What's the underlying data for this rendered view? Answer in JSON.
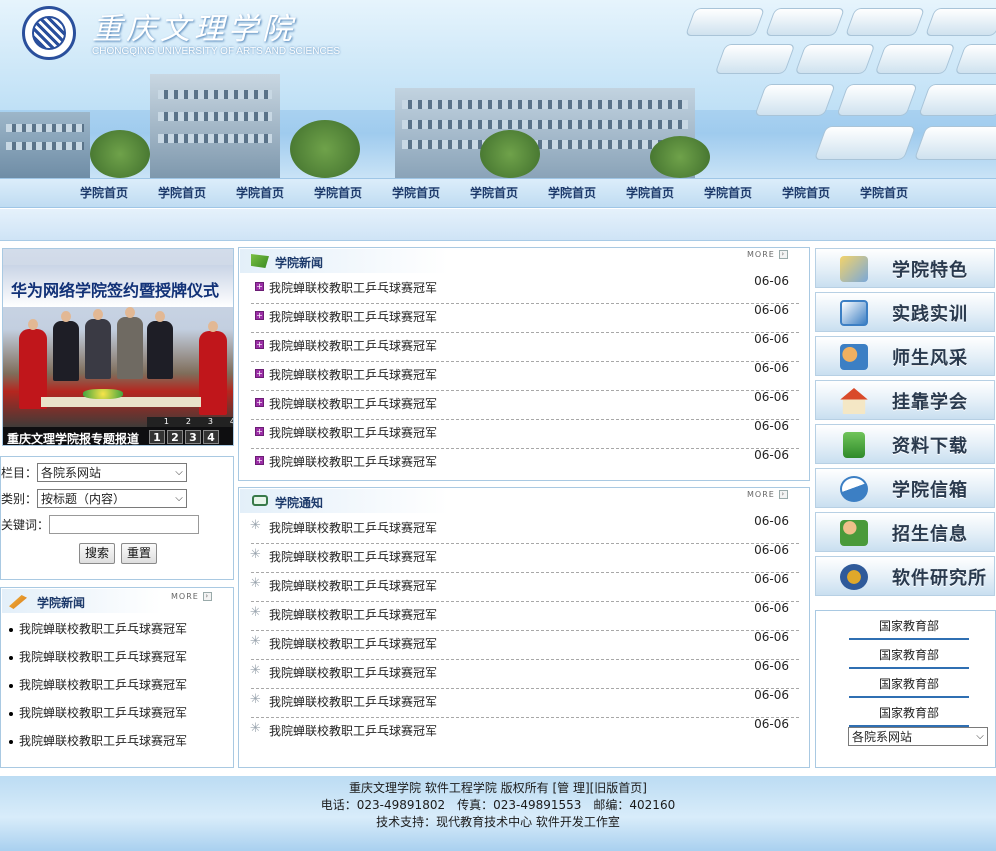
{
  "header": {
    "school_name_cn": "重庆文理学院",
    "school_name_en": "CHONGQING UNIVERSITY OF ARTS AND SCIENCES"
  },
  "nav": {
    "items": [
      "学院首页",
      "学院首页",
      "学院首页",
      "学院首页",
      "学院首页",
      "学院首页",
      "学院首页",
      "学院首页",
      "学院首页",
      "学院首页",
      "学院首页"
    ]
  },
  "slideshow": {
    "banner_text": "华为网络学院签约暨授牌仪式",
    "caption": "重庆文理学院报专题报道",
    "pages": [
      "1",
      "2",
      "3",
      "4"
    ],
    "small_pages": [
      "1",
      "2",
      "3",
      "4"
    ]
  },
  "search": {
    "column_label": "栏目：",
    "column_value": "各院系网站",
    "type_label": "类别：",
    "type_value": "按标题（内容）",
    "keyword_label": "关键词：",
    "keyword_value": "",
    "search_button": "搜索",
    "reset_button": "重置"
  },
  "left_news": {
    "title": "学院新闻",
    "more": "MORE",
    "items": [
      "我院蝉联校教职工乒乓球赛冠军",
      "我院蝉联校教职工乒乓球赛冠军",
      "我院蝉联校教职工乒乓球赛冠军",
      "我院蝉联校教职工乒乓球赛冠军",
      "我院蝉联校教职工乒乓球赛冠军"
    ]
  },
  "center_news": {
    "title": "学院新闻",
    "more": "MORE",
    "items": [
      {
        "title": "我院蝉联校教职工乒乓球赛冠军",
        "date": "06-06"
      },
      {
        "title": "我院蝉联校教职工乒乓球赛冠军",
        "date": "06-06"
      },
      {
        "title": "我院蝉联校教职工乒乓球赛冠军",
        "date": "06-06"
      },
      {
        "title": "我院蝉联校教职工乒乓球赛冠军",
        "date": "06-06"
      },
      {
        "title": "我院蝉联校教职工乒乓球赛冠军",
        "date": "06-06"
      },
      {
        "title": "我院蝉联校教职工乒乓球赛冠军",
        "date": "06-06"
      },
      {
        "title": "我院蝉联校教职工乒乓球赛冠军",
        "date": "06-06"
      }
    ]
  },
  "center_notice": {
    "title": "学院通知",
    "more": "MORE",
    "items": [
      {
        "title": "我院蝉联校教职工乒乓球赛冠军",
        "date": "06-06"
      },
      {
        "title": "我院蝉联校教职工乒乓球赛冠军",
        "date": "06-06"
      },
      {
        "title": "我院蝉联校教职工乒乓球赛冠军",
        "date": "06-06"
      },
      {
        "title": "我院蝉联校教职工乒乓球赛冠军",
        "date": "06-06"
      },
      {
        "title": "我院蝉联校教职工乒乓球赛冠军",
        "date": "06-06"
      },
      {
        "title": "我院蝉联校教职工乒乓球赛冠军",
        "date": "06-06"
      },
      {
        "title": "我院蝉联校教职工乒乓球赛冠军",
        "date": "06-06"
      },
      {
        "title": "我院蝉联校教职工乒乓球赛冠军",
        "date": "06-06"
      }
    ]
  },
  "right_menu": [
    {
      "label": "学院特色",
      "icon": "coins-icon",
      "color": "#7aa8d8"
    },
    {
      "label": "实践实训",
      "icon": "chart-icon",
      "color": "#3c7fc4"
    },
    {
      "label": "师生风采",
      "icon": "people-icon",
      "color": "#e08a2a"
    },
    {
      "label": "挂靠学会",
      "icon": "home-icon",
      "color": "#d94a2a"
    },
    {
      "label": "资料下载",
      "icon": "download-icon",
      "color": "#4a9a3a"
    },
    {
      "label": "学院信箱",
      "icon": "mail-icon",
      "color": "#3c7fc4"
    },
    {
      "label": "招生信息",
      "icon": "user-icon",
      "color": "#4a9a3a"
    },
    {
      "label": "软件研究所",
      "icon": "globe-icon",
      "color": "#e0a82a"
    }
  ],
  "right_links": {
    "items": [
      "国家教育部",
      "国家教育部",
      "国家教育部",
      "国家教育部"
    ],
    "select_value": "各院系网站"
  },
  "footer": {
    "line1": "重庆文理学院 软件工程学院 版权所有 [管 理][旧版首页]",
    "line2": "电话：023-49891802　传真：023-49891553　邮编：402160",
    "line3": "技术支持：现代教育技术中心 软件开发工作室"
  }
}
